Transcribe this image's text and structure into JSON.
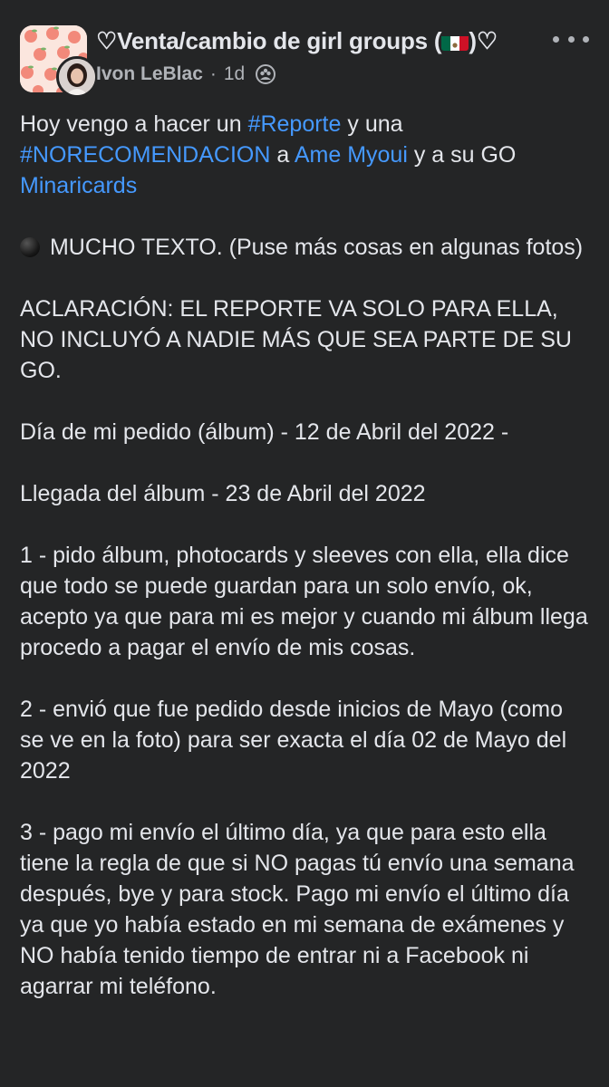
{
  "header": {
    "group_name_prefix": "♡Venta/cambio de girl groups (",
    "group_name_suffix": ")♡",
    "flag_icon": "mexico-flag-icon",
    "author": "Ivon LeBlac",
    "dot": "·",
    "time": "1d",
    "privacy_icon": "group-members-icon"
  },
  "post": {
    "p1": {
      "t1": "Hoy vengo a hacer un ",
      "l1": "#Reporte",
      "t2": " y una ",
      "l2": "#NORECOMENDACION",
      "t3": " a ",
      "l3": "Ame Myoui",
      "t4": " y a su GO ",
      "l4": "Minaricards"
    },
    "p2": "MUCHO TEXTO. (Puse más cosas en algunas fotos)",
    "p3": "ACLARACIÓN: EL REPORTE VA SOLO PARA ELLA, NO INCLUYÓ A NADIE MÁS QUE SEA PARTE DE SU GO.",
    "p4": "Día de mi pedido (álbum) - 12 de Abril del 2022 -",
    "p5": "Llegada del álbum - 23 de Abril del 2022",
    "p6": "1 - pido álbum, photocards y sleeves con ella, ella dice que todo se puede guardan para un solo envío, ok, acepto ya que para mi es mejor y cuando mi álbum llega procedo a pagar el envío de mis cosas.",
    "p7": "2 - envió que fue pedido desde inicios de Mayo (como se ve en la foto) para ser exacta el día 02 de Mayo del 2022",
    "p8": "3 - pago mi envío el último día, ya que para esto ella tiene la regla de que si NO pagas tú envío una semana después, bye y para stock. Pago mi envío el último día ya que yo había estado en mi semana de exámenes y NO había tenido tiempo de entrar ni a Facebook ni agarrar mi teléfono."
  },
  "colors": {
    "background": "#242526",
    "text": "#e4e6eb",
    "secondary": "#b0b3b8",
    "link": "#4599ff"
  }
}
